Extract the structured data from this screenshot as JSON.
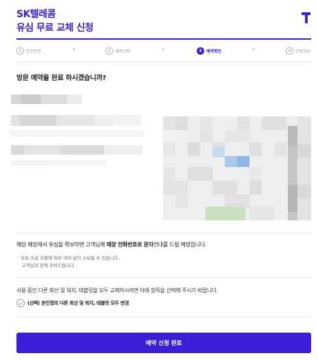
{
  "header": {
    "brand": "SK텔레콤",
    "title": "유심 무료 교체 신청",
    "logo_icon": "t-logo-icon"
  },
  "steps": [
    {
      "num": "1",
      "label": "본인인증",
      "active": false
    },
    {
      "num": "2",
      "label": "매장선택",
      "active": false
    },
    {
      "num": "3",
      "label": "예약확인",
      "active": true
    },
    {
      "num": "4",
      "label": "신청완료",
      "active": false
    }
  ],
  "question": "방문 예약을 완료 하시겠습니까?",
  "notice": {
    "prefix": "해당 매장에서 유심을 확보하면 고객님께 ",
    "bold": "매장 전화번호로 문자",
    "suffix": "안내를 드릴 예정입니다.",
    "sub_line1": "· 유심 수급 상황에 따라 여러 날이 소요될 수 있습니다.",
    "sub_line2": "고객님의 양해 부탁드립니다."
  },
  "option": {
    "instruction": "사용 중인 다른 회선 및 워치, 태블릿을 모두 교체하시려면 아래 항목을 선택해 주시기 바랍니다.",
    "checkbox_label": "(선택) 본인명의 다른 회선 및 워치, 태블릿 모두 변경",
    "checked": false
  },
  "submit_label": "예약 신청 완료",
  "colors": {
    "accent": "#3a1fd6",
    "divider": "#e8e8e8"
  }
}
